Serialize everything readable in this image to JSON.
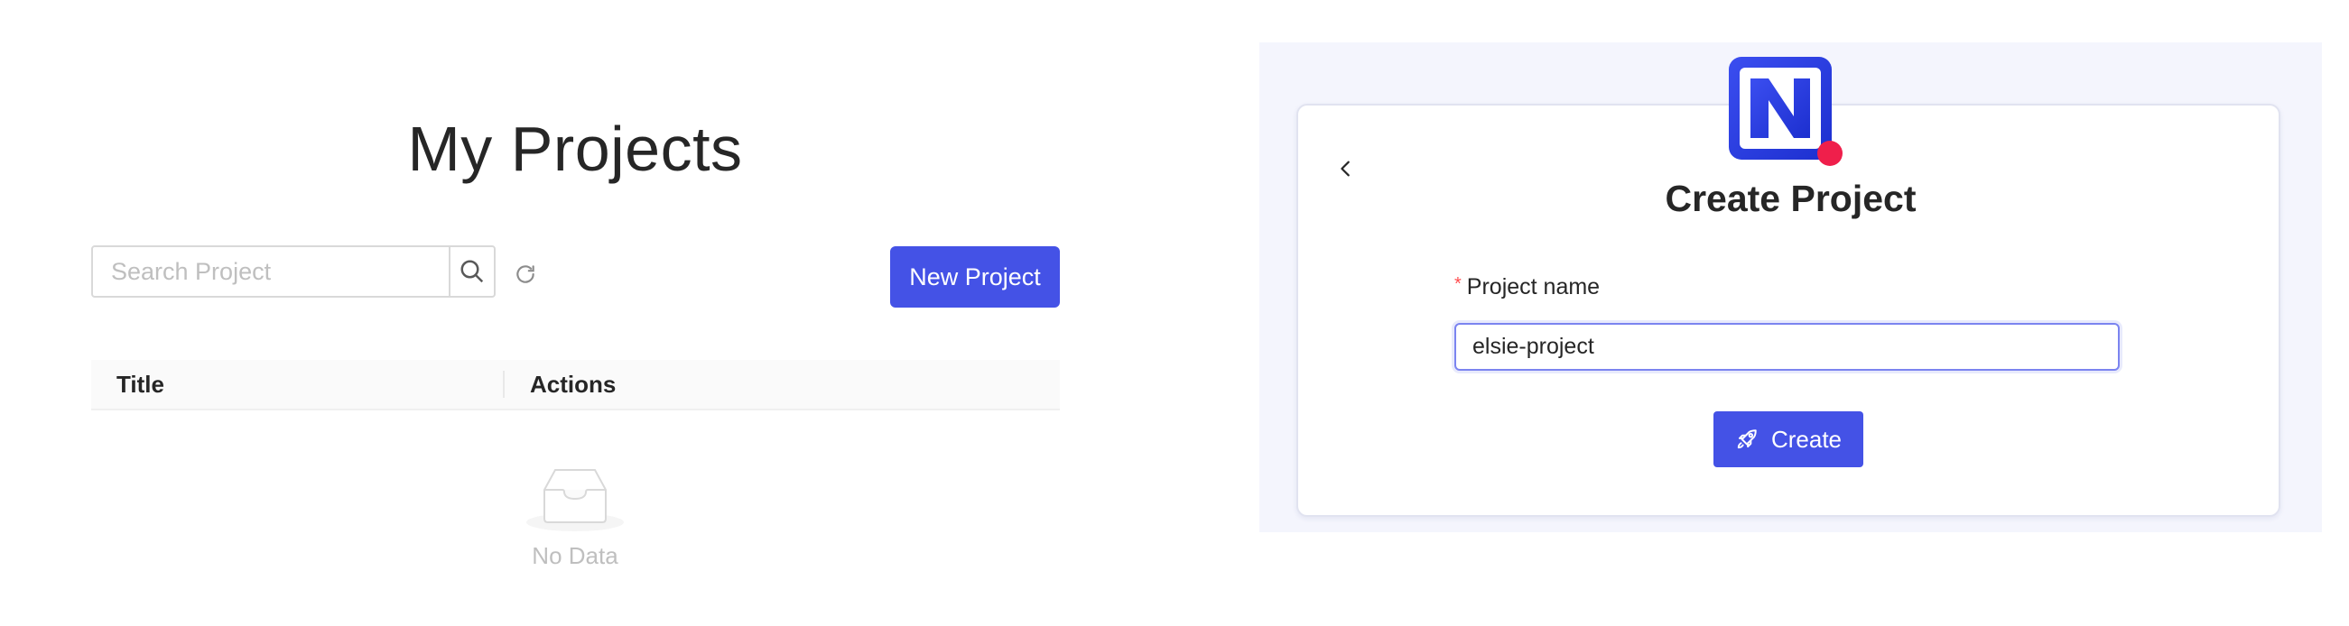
{
  "projects": {
    "title": "My Projects",
    "search": {
      "placeholder": "Search Project",
      "value": ""
    },
    "new_project_label": "New Project",
    "table": {
      "columns": [
        "Title",
        "Actions"
      ],
      "rows": []
    },
    "empty_text": "No Data"
  },
  "create_project": {
    "title": "Create Project",
    "field_label": "Project name",
    "required_mark": "*",
    "field_value": "elsie-project",
    "submit_label": "Create"
  },
  "icons": {
    "search": "search-icon",
    "reload": "reload-icon",
    "empty": "inbox-icon",
    "back": "chevron-left-icon",
    "rocket": "rocket-icon",
    "logo": "n-logo-icon"
  },
  "colors": {
    "accent": "#4452e6",
    "logo_dot": "#ef1f4b",
    "right_background": "#f4f5fd",
    "required": "#ff4d4f"
  }
}
